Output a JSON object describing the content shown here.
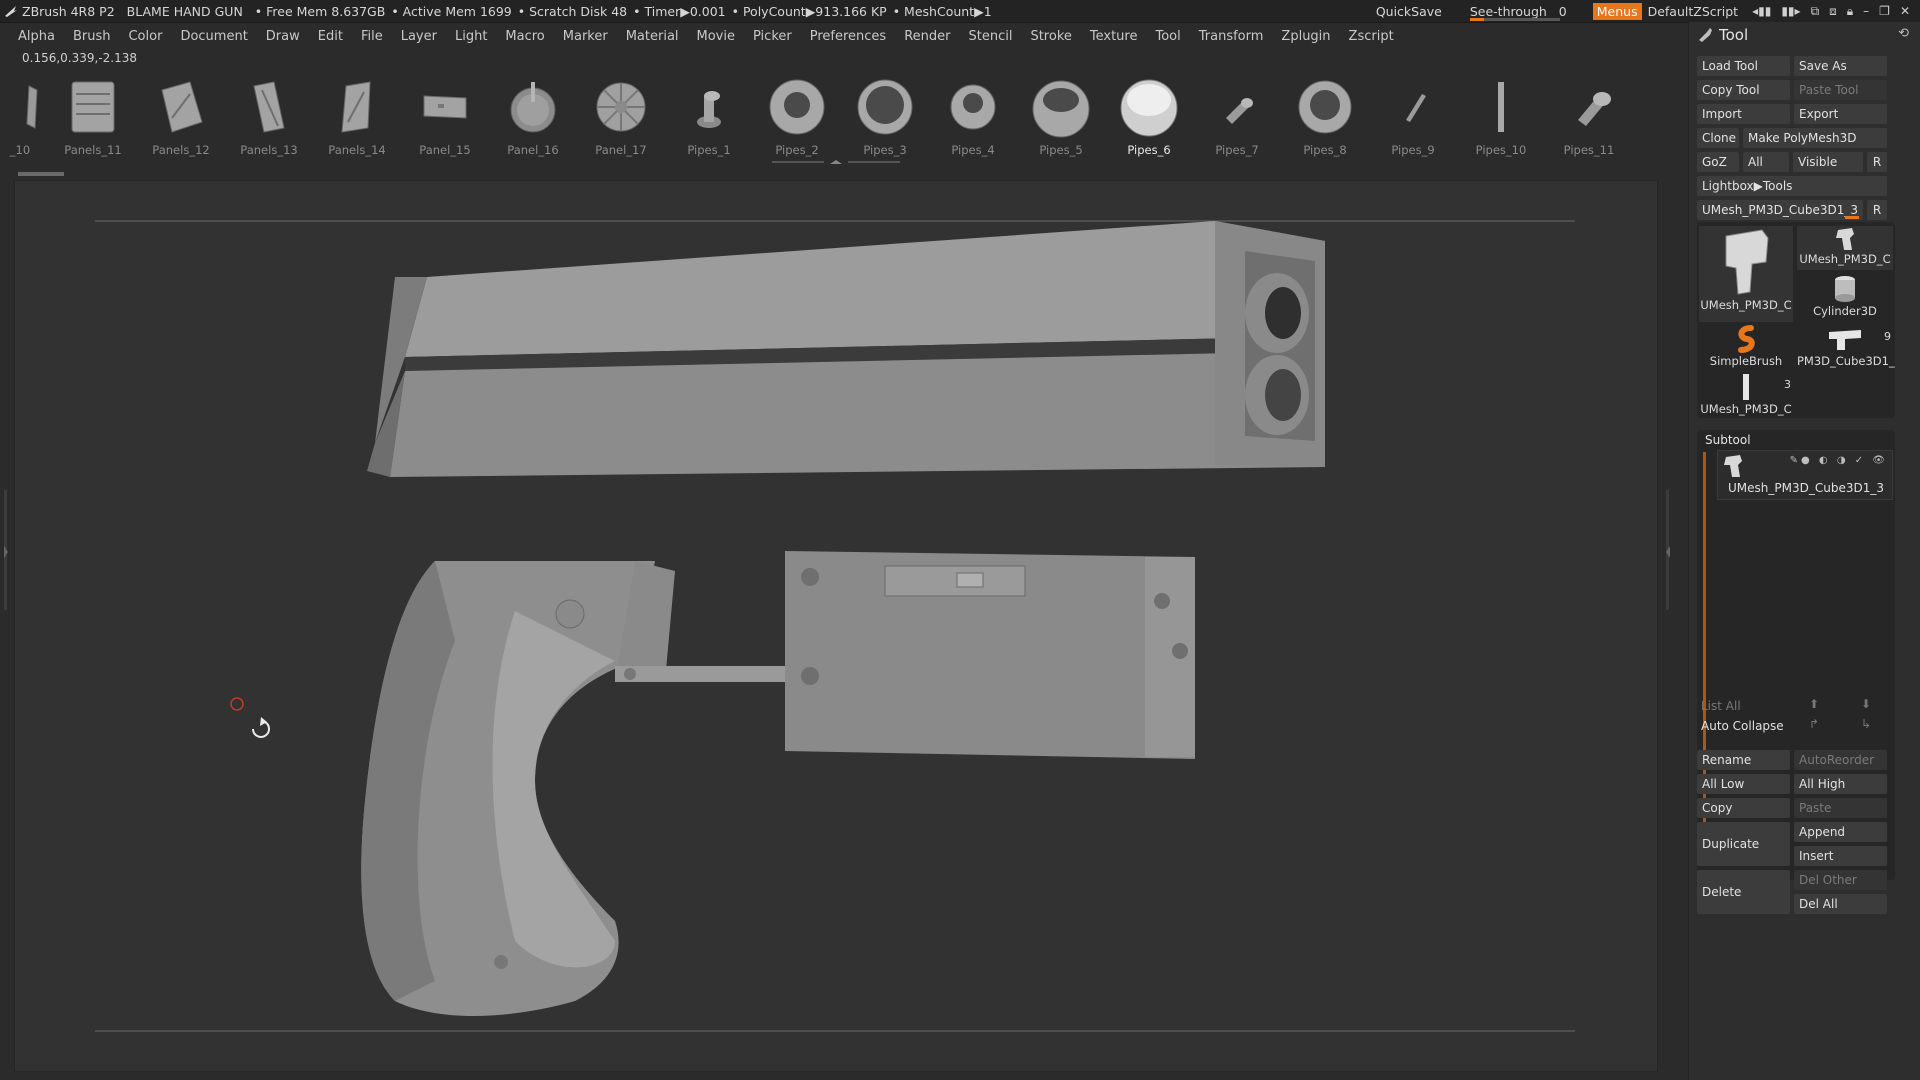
{
  "titlebar": {
    "app": "ZBrush 4R8 P2",
    "document": "BLAME HAND GUN",
    "free_mem": "• Free Mem 8.637GB",
    "active_mem": "• Active Mem 1699",
    "scratch_disk": "• Scratch Disk 48",
    "timer": "• Timer▶0.001",
    "polycount": "• PolyCount▶913.166 KP",
    "meshcount": "• MeshCount▶1",
    "quicksave": "QuickSave",
    "see_through_label": "See-through",
    "see_through_value": "0",
    "see_through_level": 0,
    "menus": "Menus",
    "script": "DefaultZScript",
    "accent_color": "#e8761b"
  },
  "menubar": [
    "Alpha",
    "Brush",
    "Color",
    "Document",
    "Draw",
    "Edit",
    "File",
    "Layer",
    "Light",
    "Macro",
    "Marker",
    "Material",
    "Movie",
    "Picker",
    "Preferences",
    "Render",
    "Stencil",
    "Stroke",
    "Texture",
    "Tool",
    "Transform",
    "Zplugin",
    "Zscript"
  ],
  "coords": "0.156,0.339,-2.138",
  "strip": [
    {
      "label": "_10",
      "icon": "panel-thumb"
    },
    {
      "label": "Panels_11",
      "icon": "panel-thumb"
    },
    {
      "label": "Panels_12",
      "icon": "panel-thumb"
    },
    {
      "label": "Panels_13",
      "icon": "panel-thumb"
    },
    {
      "label": "Panels_14",
      "icon": "panel-thumb"
    },
    {
      "label": "Panel_15",
      "icon": "panel-thumb"
    },
    {
      "label": "Panel_16",
      "icon": "knob-thumb"
    },
    {
      "label": "Panel_17",
      "icon": "wheel-thumb"
    },
    {
      "label": "Pipes_1",
      "icon": "pipe-thumb"
    },
    {
      "label": "Pipes_2",
      "icon": "ring-thumb"
    },
    {
      "label": "Pipes_3",
      "icon": "ring-thumb"
    },
    {
      "label": "Pipes_4",
      "icon": "ring-thumb"
    },
    {
      "label": "Pipes_5",
      "icon": "ring-thumb"
    },
    {
      "label": "Pipes_6",
      "icon": "cylinder-thumb",
      "selected": true
    },
    {
      "label": "Pipes_7",
      "icon": "pipe-thumb"
    },
    {
      "label": "Pipes_8",
      "icon": "ring-thumb"
    },
    {
      "label": "Pipes_9",
      "icon": "pipe-thumb"
    },
    {
      "label": "Pipes_10",
      "icon": "rod-thumb"
    },
    {
      "label": "Pipes_11",
      "icon": "pipe-thumb"
    }
  ],
  "tool": {
    "title": "Tool",
    "load_tool": "Load Tool",
    "save_as": "Save As",
    "copy_tool": "Copy Tool",
    "paste_tool": "Paste Tool",
    "import": "Import",
    "export": "Export",
    "clone": "Clone",
    "make_polymesh": "Make PolyMesh3D",
    "goz": "GoZ",
    "all": "All",
    "visible": "Visible",
    "r": "R",
    "lightbox_tools": "Lightbox▶Tools",
    "current_tool": "UMesh_PM3D_Cube3D1_3",
    "current_r": "R",
    "thumbs": [
      {
        "label": "UMesh_PM3D_C",
        "icon": "gun-thumb"
      },
      {
        "label": "UMesh_PM3D_C",
        "icon": "gun-small-thumb"
      },
      {
        "label": "Cylinder3D",
        "icon": "cylinder-icon"
      },
      {
        "label": "SimpleBrush",
        "icon": "simplebrush-icon"
      },
      {
        "label": "PM3D_Cube3D1_",
        "icon": "gun-side-icon",
        "count": "9"
      },
      {
        "label": "UMesh_PM3D_C",
        "icon": "gun-part-icon",
        "count": "3"
      }
    ]
  },
  "subtool": {
    "title": "Subtool",
    "item_name": "UMesh_PM3D_Cube3D1_3",
    "list_all": "List All",
    "auto_collapse": "Auto Collapse",
    "rename": "Rename",
    "auto_reorder": "AutoReorder",
    "all_low": "All Low",
    "all_high": "All High",
    "copy": "Copy",
    "paste": "Paste",
    "duplicate": "Duplicate",
    "append": "Append",
    "insert": "Insert",
    "delete": "Delete",
    "del_other": "Del Other",
    "del_all": "Del All"
  }
}
